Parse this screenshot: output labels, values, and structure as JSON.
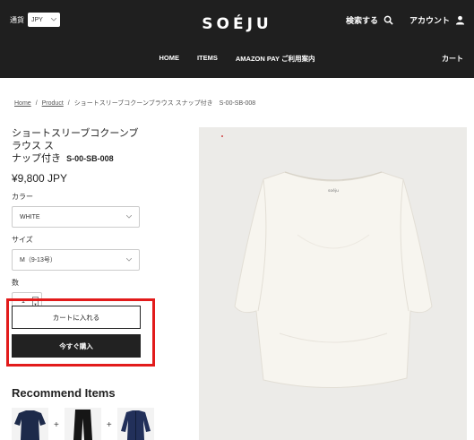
{
  "header": {
    "currency_label": "通貨",
    "currency_value": "JPY",
    "logo": "SOÉJU",
    "search_label": "検索する",
    "account_label": "アカウント",
    "nav": [
      "HOME",
      "ITEMS",
      "AMAZON PAY ご利用案内"
    ],
    "cart_label": "カート"
  },
  "breadcrumb": [
    "Home",
    "Product",
    "ショートスリーブコクーンブラウス スナップ付き　S-00-SB-008"
  ],
  "product": {
    "title": "ショートスリーブコクーンブラウス ス",
    "title_line2": "ナップ付き",
    "code": "S-00-SB-008",
    "price": "¥9,800 JPY",
    "color_label": "カラー",
    "color_value": "WHITE",
    "size_label": "サイズ",
    "size_value": "M（9-13号）",
    "qty_label": "数",
    "qty_value": "1",
    "add_to_cart": "カートに入れる",
    "buy_now": "今すぐ購入",
    "shirt_tag": "soéju"
  },
  "recommend": {
    "title": "Recommend Items",
    "plus": "+"
  },
  "colors": {
    "header_bg": "#1f1f1f",
    "highlight": "#e21b1b",
    "navy": "#1d2a4a"
  }
}
